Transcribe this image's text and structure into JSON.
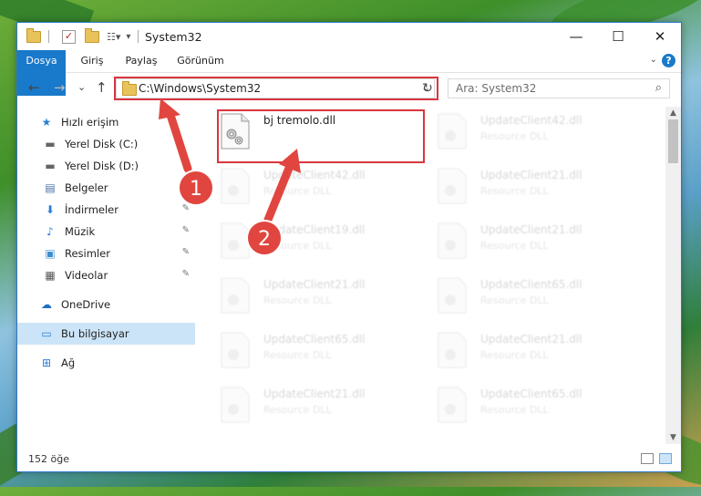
{
  "window": {
    "title": "System32",
    "minimize_glyph": "—",
    "maximize_glyph": "☐",
    "close_glyph": "✕"
  },
  "ribbon": {
    "tabs": [
      "Dosya",
      "Giriş",
      "Paylaş",
      "Görünüm"
    ],
    "help_glyph": "?",
    "collapse_glyph": "⌄"
  },
  "nav": {
    "back_glyph": "←",
    "forward_glyph": "→",
    "recent_glyph": "⌄",
    "up_glyph": "↑",
    "address": "C:\\Windows\\System32",
    "address_dropdown_glyph": "⌄",
    "refresh_glyph": "↻",
    "search_placeholder": "Ara: System32",
    "search_glyph": "⌕"
  },
  "sidebar": {
    "items": [
      {
        "label": "Hızlı erişim",
        "icon": "star-icon",
        "glyph": "★"
      },
      {
        "label": "Yerel Disk (C:)",
        "icon": "drive-icon",
        "glyph": "▬"
      },
      {
        "label": "Yerel Disk (D:)",
        "icon": "drive-icon",
        "glyph": "▬"
      },
      {
        "label": "Belgeler",
        "icon": "document-icon",
        "glyph": "▤"
      },
      {
        "label": "İndirmeler",
        "icon": "download-icon",
        "glyph": "⬇"
      },
      {
        "label": "Müzik",
        "icon": "music-icon",
        "glyph": "♪"
      },
      {
        "label": "Resimler",
        "icon": "pictures-icon",
        "glyph": "▣"
      },
      {
        "label": "Videolar",
        "icon": "video-icon",
        "glyph": "▦"
      },
      {
        "label": "OneDrive",
        "icon": "cloud-icon",
        "glyph": "☁"
      },
      {
        "label": "Bu bilgisayar",
        "icon": "computer-icon",
        "glyph": "▭"
      },
      {
        "label": "Ağ",
        "icon": "network-icon",
        "glyph": "⊞"
      }
    ]
  },
  "files": [
    {
      "name": "bj tremolo.dll",
      "type": ""
    },
    {
      "name": "UpdateClient42.dll",
      "type": "Resource DLL"
    },
    {
      "name": "UpdateClient42.dll",
      "type": "Resource DLL"
    },
    {
      "name": "UpdateClient21.dll",
      "type": "Resource DLL"
    },
    {
      "name": "UpdateClient19.dll",
      "type": "Resource DLL"
    },
    {
      "name": "UpdateClient21.dll",
      "type": "Resource DLL"
    },
    {
      "name": "UpdateClient21.dll",
      "type": "Resource DLL"
    },
    {
      "name": "UpdateClient65.dll",
      "type": "Resource DLL"
    },
    {
      "name": "UpdateClient65.dll",
      "type": "Resource DLL"
    },
    {
      "name": "UpdateClient21.dll",
      "type": "Resource DLL"
    },
    {
      "name": "UpdateClient21.dll",
      "type": "Resource DLL"
    },
    {
      "name": "UpdateClient65.dll",
      "type": "Resource DLL"
    }
  ],
  "status": {
    "item_count": "152 öğe"
  },
  "annotations": {
    "step1": "1",
    "step2": "2",
    "color": "#d9363e"
  }
}
